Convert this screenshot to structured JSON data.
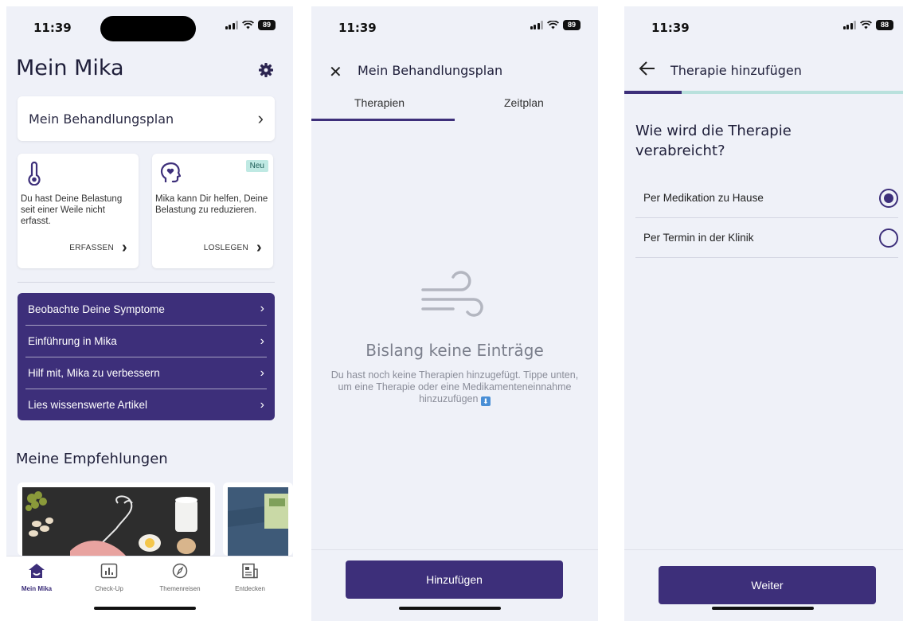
{
  "screen1": {
    "status": {
      "time": "11:39",
      "battery": "89"
    },
    "title": "Mein Mika",
    "plan_card": {
      "label": "Mein Behandlungsplan"
    },
    "tile1": {
      "text": "Du hast Deine Belastung seit einer Weile nicht erfasst.",
      "cta": "ERFASSEN"
    },
    "tile2": {
      "badge": "Neu",
      "text": "Mika kann Dir helfen, Deine Belastung zu reduzieren.",
      "cta": "LOSLEGEN"
    },
    "menu": [
      {
        "label": "Beobachte Deine Symptome"
      },
      {
        "label": "Einführung in Mika"
      },
      {
        "label": "Hilf mit, Mika zu verbessern"
      },
      {
        "label": "Lies wissenswerte Artikel"
      }
    ],
    "recommendations_title": "Meine Empfehlungen",
    "tabs": [
      {
        "label": "Mein Mika",
        "icon": "home-icon"
      },
      {
        "label": "Check-Up",
        "icon": "chart-icon"
      },
      {
        "label": "Themenreisen",
        "icon": "compass-icon"
      },
      {
        "label": "Entdecken",
        "icon": "newspaper-icon"
      }
    ]
  },
  "screen2": {
    "status": {
      "time": "11:39",
      "battery": "89"
    },
    "title": "Mein Behandlungsplan",
    "tabs": [
      {
        "label": "Therapien"
      },
      {
        "label": "Zeitplan"
      }
    ],
    "empty": {
      "title": "Bislang keine Einträge",
      "text": "Du hast noch keine Therapien hinzugefügt. Tippe unten, um eine Therapie oder eine Medikamenteneinnahme hinzuzufügen"
    },
    "button": "Hinzufügen"
  },
  "screen3": {
    "status": {
      "time": "11:39",
      "battery": "88"
    },
    "title": "Therapie hinzufügen",
    "progress": 0.2,
    "question": "Wie wird die Therapie verabreicht?",
    "options": [
      {
        "label": "Per Medikation zu Hause",
        "selected": true
      },
      {
        "label": "Per Termin in der Klinik",
        "selected": false
      }
    ],
    "button": "Weiter"
  },
  "colors": {
    "accent": "#3d2f7a",
    "background": "#eff1f8",
    "progress_track": "#b9e1dd",
    "badge": "#bfe9e3"
  }
}
